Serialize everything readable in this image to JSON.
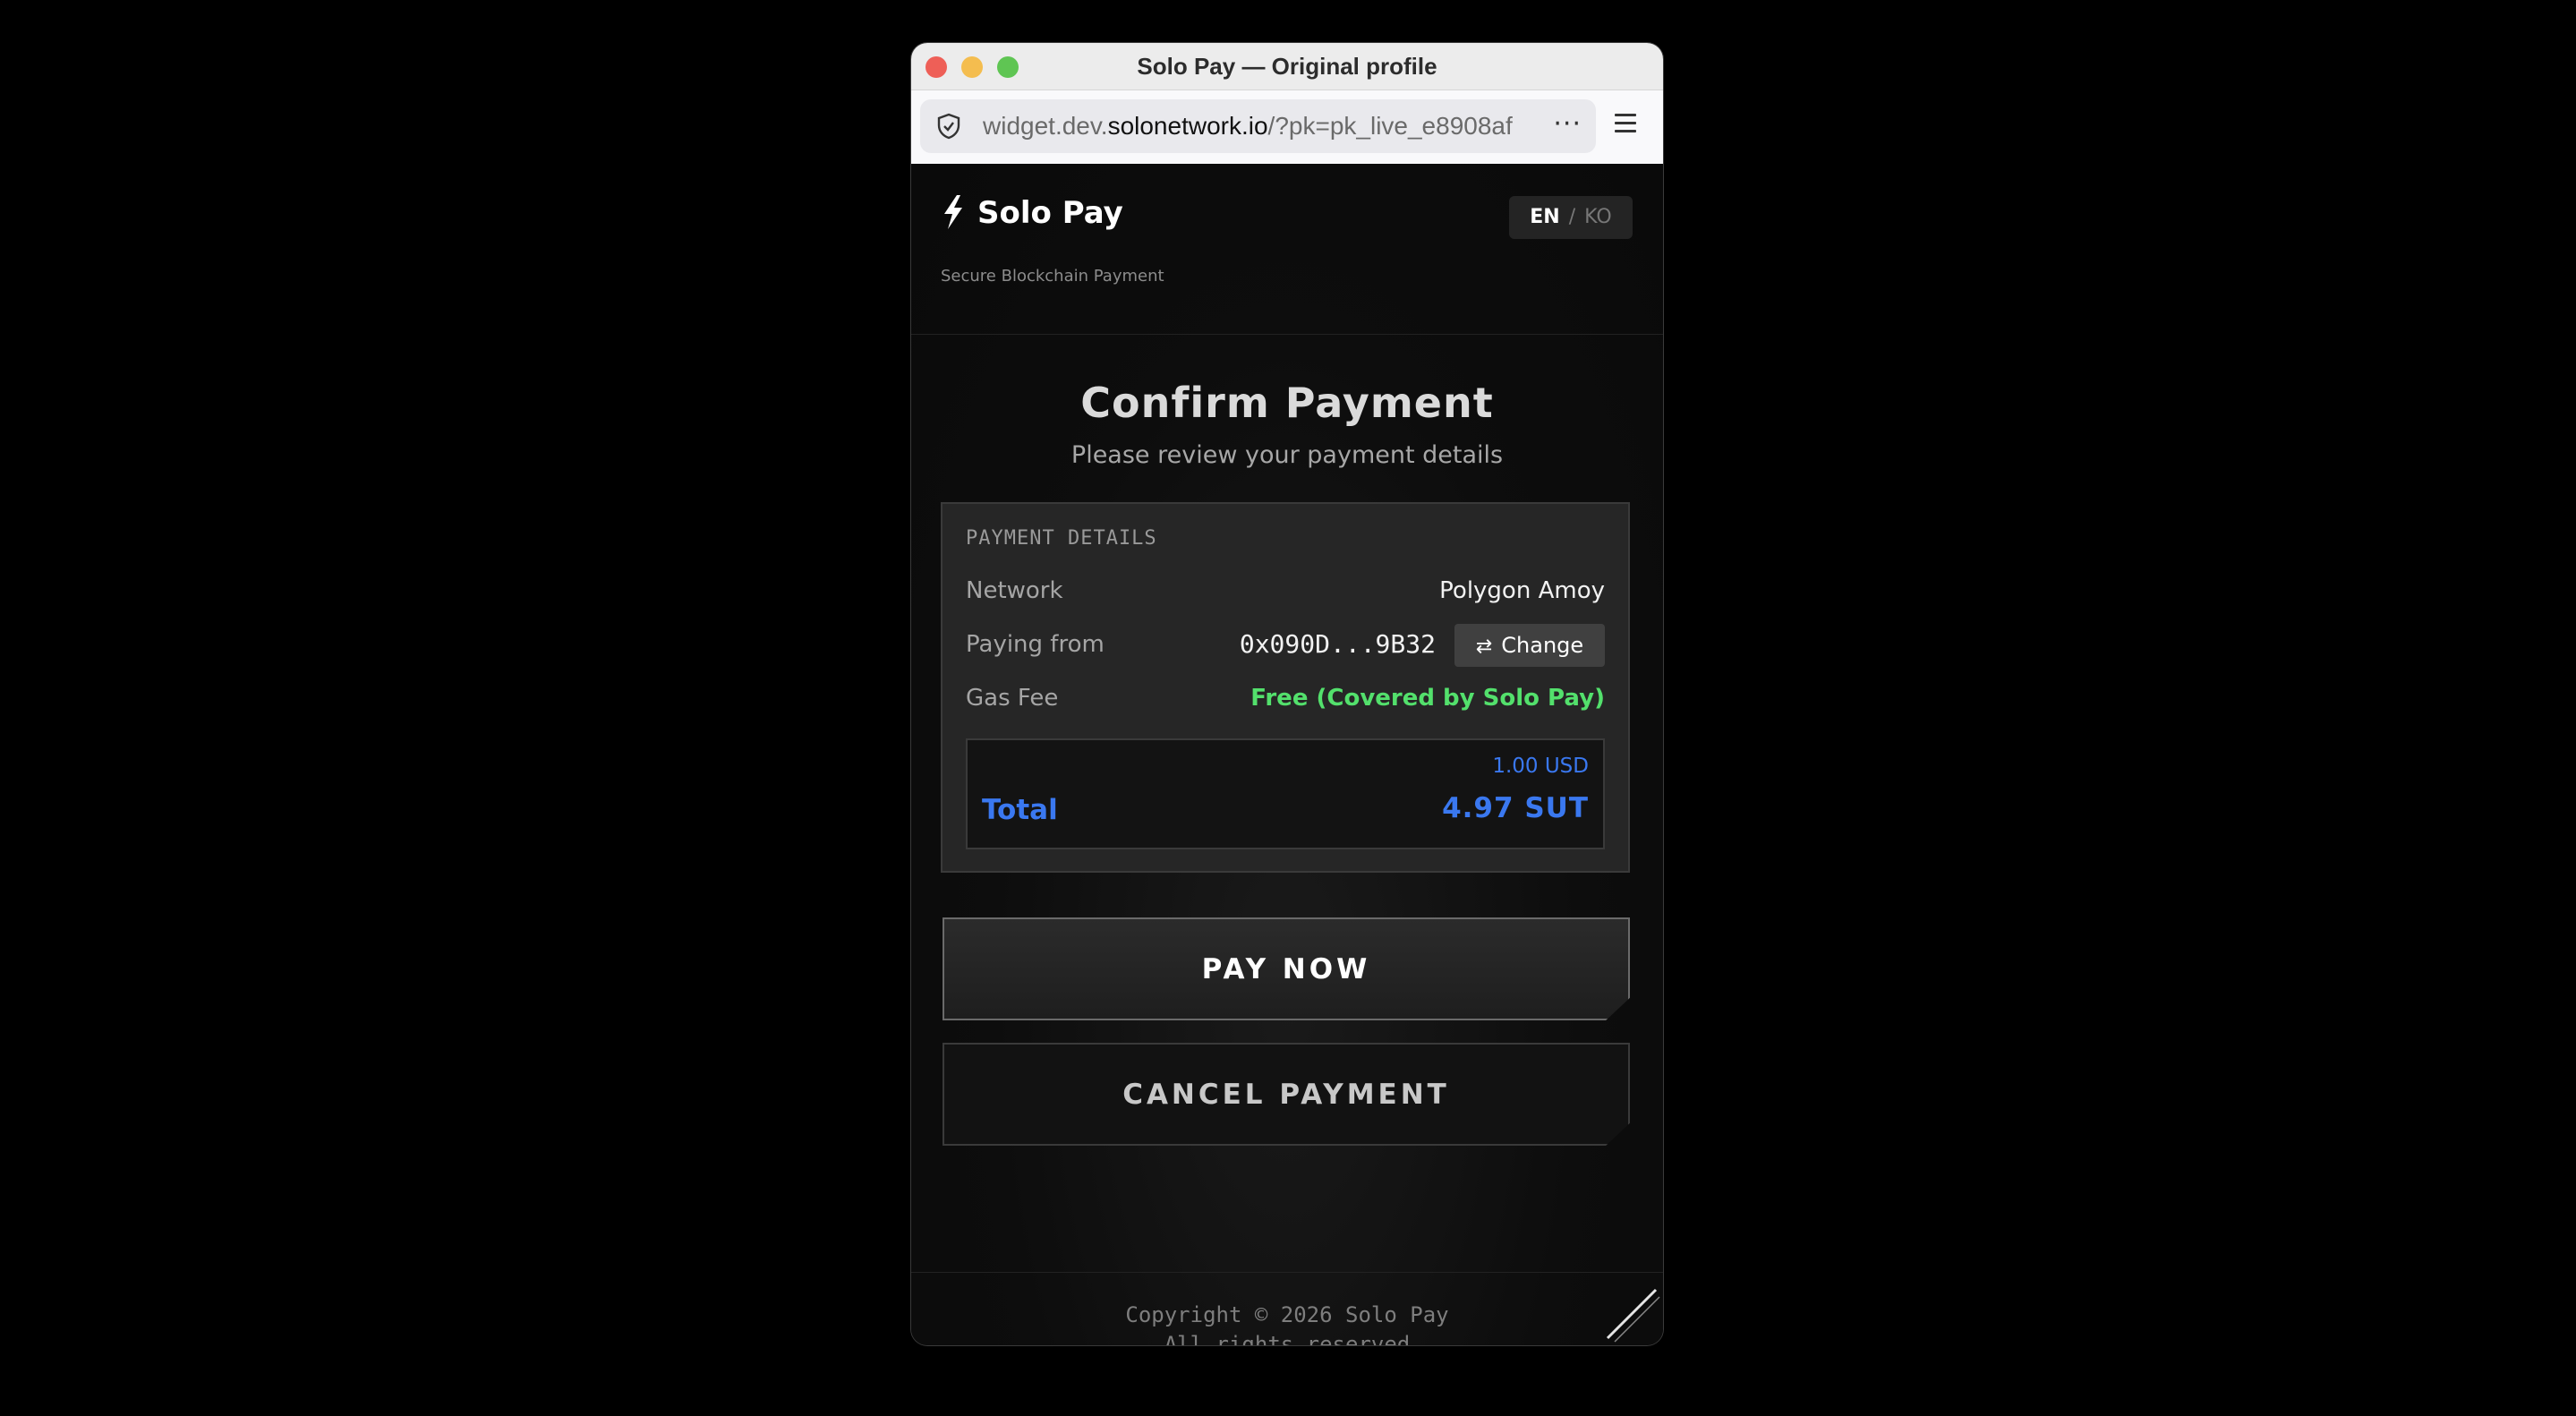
{
  "window": {
    "title": "Solo Pay — Original profile"
  },
  "browser": {
    "url_prefix": "widget.dev.",
    "url_domain": "solonetwork.io",
    "url_rest": "/?pk=pk_live_e8908af",
    "more": "···"
  },
  "header": {
    "brand_name": "Solo Pay",
    "brand_subtitle": "Secure Blockchain Payment",
    "lang_en": "EN",
    "lang_sep": "/",
    "lang_ko": "KO"
  },
  "main": {
    "title": "Confirm Payment",
    "subtitle": "Please review your payment details"
  },
  "details": {
    "section_title": "PAYMENT DETAILS",
    "network_label": "Network",
    "network_value": "Polygon Amoy",
    "paying_from_label": "Paying from",
    "paying_from_value": "0x090D...9B32",
    "change_label": "Change",
    "gas_fee_label": "Gas Fee",
    "gas_fee_value": "Free (Covered by Solo Pay)",
    "usd_value": "1.00 USD",
    "total_label": "Total",
    "total_value": "4.97 SUT"
  },
  "actions": {
    "pay_now": "PAY NOW",
    "cancel": "CANCEL PAYMENT"
  },
  "footer": {
    "copyright": "Copyright © 2026 Solo Pay",
    "rights": "All rights reserved"
  },
  "colors": {
    "accent_blue": "#3a78f0",
    "success_green": "#53e06c"
  }
}
